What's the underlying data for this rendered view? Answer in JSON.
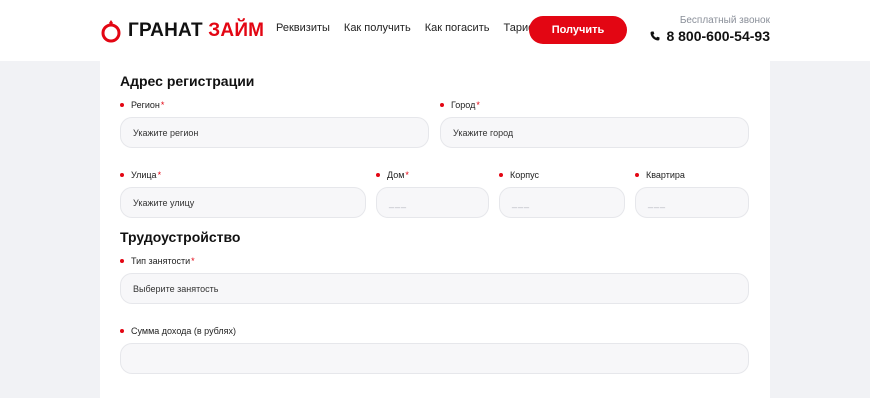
{
  "header": {
    "logo_word1": "ГРАНАТ",
    "logo_word2": "ЗАЙМ",
    "nav": [
      "Реквизиты",
      "Как получить",
      "Как погасить",
      "Тарифы"
    ],
    "cta_label": "Получить",
    "call_caption": "Бесплатный звонок",
    "phone": "8 800-600-54-93"
  },
  "colors": {
    "accent": "#e30613",
    "field_bg": "#f7f7f9",
    "page_bg": "#f1f2f5"
  },
  "address": {
    "title": "Адрес регистрации",
    "region": {
      "label": "Регион",
      "placeholder": "Укажите регион"
    },
    "city": {
      "label": "Город",
      "placeholder": "Укажите город"
    },
    "street": {
      "label": "Улица",
      "placeholder": "Укажите улицу"
    },
    "house": {
      "label": "Дом",
      "placeholder": "___"
    },
    "building": {
      "label": "Корпус",
      "placeholder": "___"
    },
    "apartment": {
      "label": "Квартира",
      "placeholder": "___"
    }
  },
  "employment": {
    "title": "Трудоустройство",
    "type": {
      "label": "Тип занятости",
      "placeholder": "Выберите занятость"
    },
    "income": {
      "label": "Сумма дохода (в рублях)",
      "placeholder": ""
    }
  },
  "required_mark": "*"
}
